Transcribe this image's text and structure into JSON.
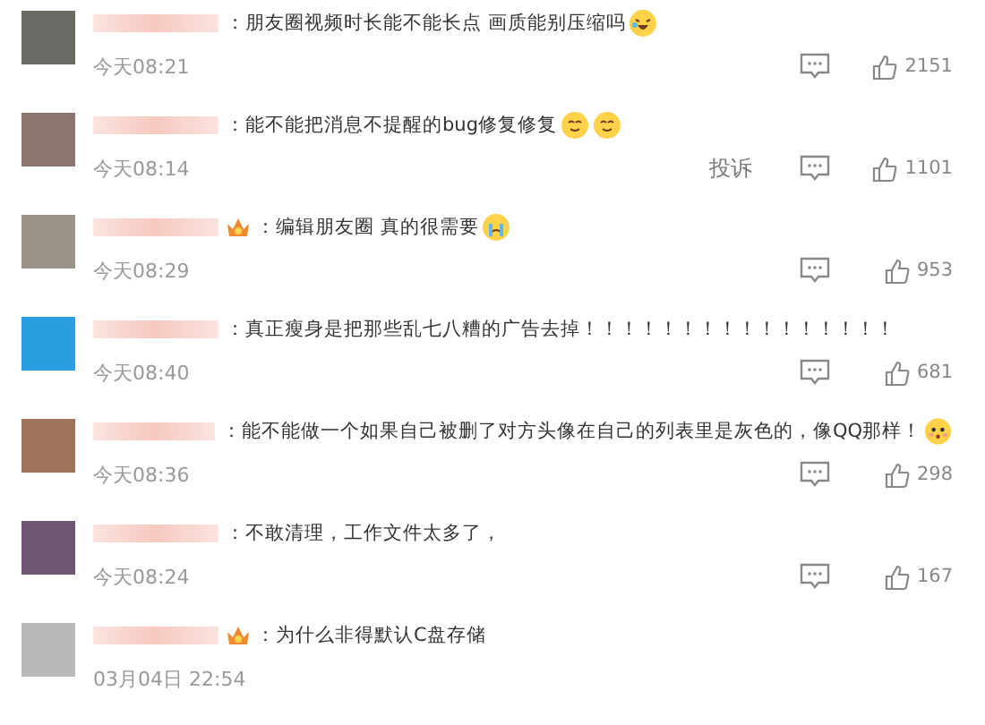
{
  "comments": [
    {
      "avatar": {
        "color": "#6b6b66"
      },
      "badge": false,
      "text": "：朋友圈视频时长能不能长点 画质能别压缩吗",
      "emojis": [
        {
          "kind": "laugh"
        }
      ],
      "time": "今天08:21",
      "likes": "2151"
    },
    {
      "avatar": {
        "color": "#8a7570"
      },
      "badge": false,
      "text": "：能不能把消息不提醒的bug修复修复",
      "emojis": [
        {
          "kind": "smile"
        },
        {
          "kind": "smile"
        }
      ],
      "time": "今天08:14",
      "report": "投诉",
      "likes": "1101"
    },
    {
      "avatar": {
        "color": "#9a9488"
      },
      "badge": true,
      "text": "：编辑朋友圈 真的很需要",
      "emojis": [
        {
          "kind": "cry"
        }
      ],
      "time": "今天08:29",
      "likes": "953"
    },
    {
      "avatar": {
        "color": "#2a9ee0"
      },
      "badge": false,
      "text": "：真正瘦身是把那些乱七八糟的广告去掉！！！！！！！！！！！！！！！！",
      "time": "今天08:40",
      "likes": "681"
    },
    {
      "avatar": {
        "color": "#a0745a"
      },
      "badge": false,
      "text": "：能不能做一个如果自己被删了对方头像在自己的列表里是灰色的，像QQ那样！",
      "emojis": [
        {
          "kind": "shy"
        }
      ],
      "time": "今天08:36",
      "likes": "298"
    },
    {
      "avatar": {
        "color": "#6e5670"
      },
      "badge": false,
      "text": "：不敢清理，工作文件太多了，",
      "time": "今天08:24",
      "likes": "167"
    },
    {
      "avatar": {
        "color": "#b8b8b8"
      },
      "badge": true,
      "text": "：为什么非得默认C盘存储",
      "time": "03月04日 22:54"
    }
  ]
}
